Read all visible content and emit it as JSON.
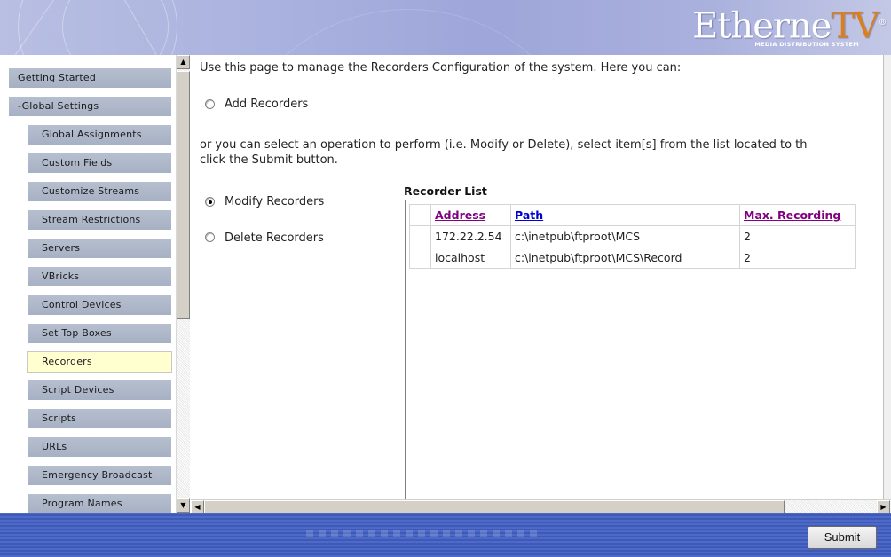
{
  "header": {
    "logo_main": "Etherne",
    "logo_accent": "TV",
    "logo_reg": "®",
    "logo_subtitle": "MEDIA DISTRIBUTION SYSTEM"
  },
  "sidebar": {
    "items": [
      {
        "label": "Getting Started",
        "level": "top",
        "active": false
      },
      {
        "label": "-Global Settings",
        "level": "top",
        "active": false
      },
      {
        "label": "Global Assignments",
        "level": "sub",
        "active": false
      },
      {
        "label": "Custom Fields",
        "level": "sub",
        "active": false
      },
      {
        "label": "Customize Streams",
        "level": "sub",
        "active": false
      },
      {
        "label": "Stream Restrictions",
        "level": "sub",
        "active": false
      },
      {
        "label": "Servers",
        "level": "sub",
        "active": false
      },
      {
        "label": "VBricks",
        "level": "sub",
        "active": false
      },
      {
        "label": "Control Devices",
        "level": "sub",
        "active": false
      },
      {
        "label": "Set Top Boxes",
        "level": "sub",
        "active": false
      },
      {
        "label": "Recorders",
        "level": "sub",
        "active": true
      },
      {
        "label": "Script Devices",
        "level": "sub",
        "active": false
      },
      {
        "label": "Scripts",
        "level": "sub",
        "active": false
      },
      {
        "label": "URLs",
        "level": "sub",
        "active": false
      },
      {
        "label": "Emergency Broadcast",
        "level": "sub",
        "active": false
      },
      {
        "label": "Program Names",
        "level": "sub",
        "active": false
      }
    ]
  },
  "main": {
    "intro": "Use this page to manage the Recorders Configuration of the system. Here you can:",
    "add_label": "Add Recorders",
    "instructions_line1": "or you can select an operation to perform (i.e. Modify or Delete), select item[s] from the list located to th",
    "instructions_line2": "click the Submit button.",
    "modify_label": "Modify Recorders",
    "delete_label": "Delete Recorders",
    "selected_operation": "modify",
    "list_title": "Recorder List",
    "columns": [
      "Address",
      "Path",
      "Max. Recording"
    ],
    "rows": [
      [
        "172.22.2.54",
        "c:\\inetpub\\ftproot\\MCS",
        "2"
      ],
      [
        "localhost",
        "c:\\inetpub\\ftproot\\MCS\\Record",
        "2"
      ]
    ]
  },
  "footer": {
    "submit_label": "Submit"
  },
  "colors": {
    "active_nav": "#ffffd0",
    "footer_blue": "#4d6ac8",
    "link_blue": "#0000cc",
    "link_visited": "#800080"
  }
}
